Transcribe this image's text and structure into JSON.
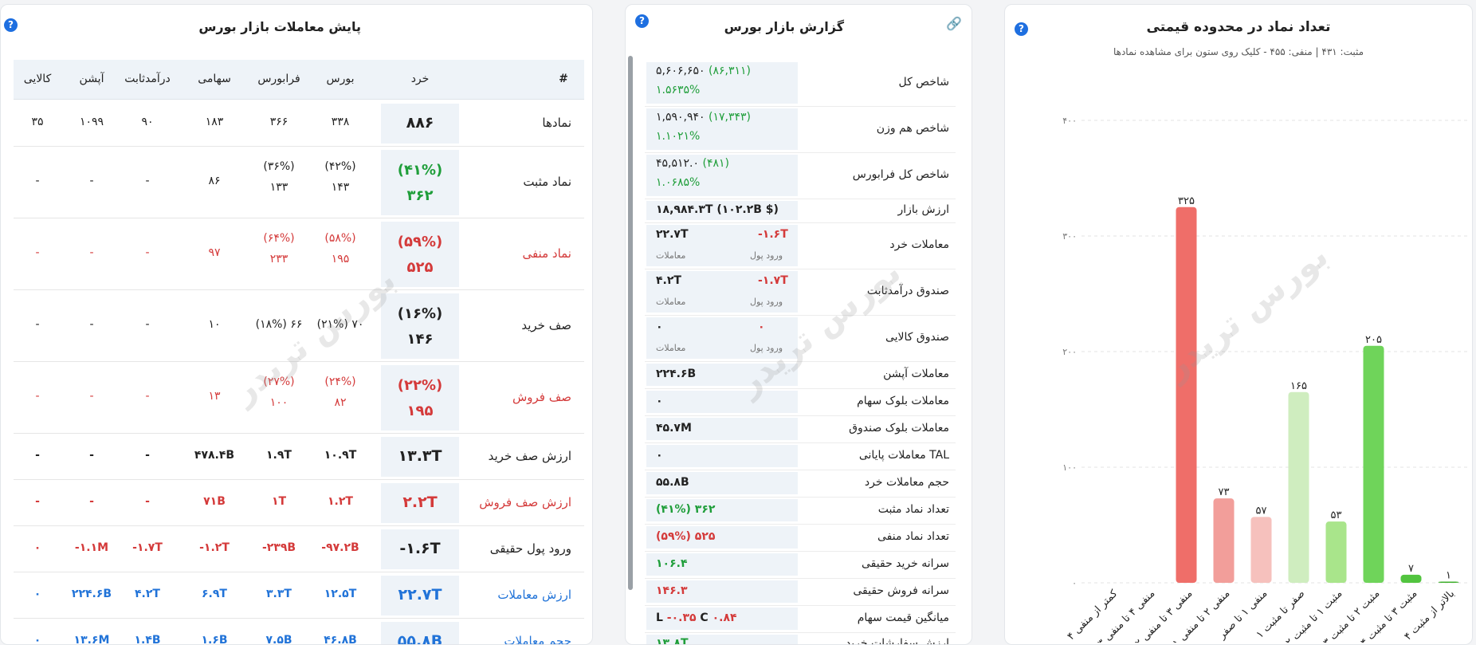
{
  "chart_panel": {
    "title": "تعداد نماد در محدوده قیمتی",
    "subtitle": "مثبت: ۴۳۱ | منفی: ۴۵۵ - کلیک روی ستون برای مشاهده نمادها",
    "watermark": "بورس تریدر"
  },
  "chart_data": {
    "type": "bar",
    "categories": [
      "کمتر از منفی ۴",
      "منفی ۴ تا منفی ۳",
      "منفی ۳ تا منفی ۲",
      "منفی ۲ تا منفی ۱",
      "منفی ۱ تا صفر",
      "صفر تا مثبت ۱",
      "مثبت ۱ تا مثبت ۲",
      "مثبت ۲ تا مثبت ۳",
      "مثبت ۳ تا مثبت ۴",
      "بالاتر از مثبت ۴"
    ],
    "values": [
      0,
      0,
      325,
      73,
      57,
      165,
      53,
      205,
      7,
      1
    ],
    "value_labels": [
      "",
      "",
      "۳۲۵",
      "۷۳",
      "۵۷",
      "۱۶۵",
      "۵۳",
      "۲۰۵",
      "۷",
      "۱"
    ],
    "colors": [
      "#e85b5b",
      "#ec6d6a",
      "#ef6e69",
      "#f29e9a",
      "#f6c1bd",
      "#cfedbf",
      "#a9e58b",
      "#6fd45a",
      "#52c43f",
      "#3faf2c"
    ],
    "ylim": [
      0,
      400
    ],
    "yticks": [
      0,
      100,
      200,
      300,
      400
    ],
    "ytick_labels": [
      "۰",
      "۱۰۰",
      "۲۰۰",
      "۳۰۰",
      "۴۰۰"
    ],
    "grid": true,
    "legend": "none"
  },
  "report_panel": {
    "title": "گزارش بازار بورس",
    "watermark": "بورس تریدر",
    "rows": [
      {
        "label": "شاخص کل",
        "v1": "۵,۶۰۶,۶۵۰",
        "v1b": "(۸۶,۳۱۱)",
        "v2": "۱.۵۶۳۵%"
      },
      {
        "label": "شاخص هم وزن",
        "v1": "۱,۵۹۰,۹۴۰",
        "v1b": "(۱۷,۳۴۳)",
        "v2": "۱.۱۰۲۱%"
      },
      {
        "label": "شاخص کل فرابورس",
        "v1": "۴۵,۵۱۲.۰",
        "v1b": "(۴۸۱)",
        "v2": "۱.۰۶۸۵%"
      },
      {
        "label": "ارزش بازار",
        "v1": "۱۸,۹۸۴.۳T (۱۰۲.۲B $)"
      },
      {
        "label": "معاملات خرد",
        "left": "۲۲.۷T",
        "right": "-۱.۶T",
        "left_sub": "معاملات",
        "right_sub": "ورود پول"
      },
      {
        "label": "صندوق درآمدثابت",
        "left": "۴.۲T",
        "right": "-۱.۷T",
        "left_sub": "معاملات",
        "right_sub": "ورود پول"
      },
      {
        "label": "صندوق کالایی",
        "left": "۰",
        "right": "۰",
        "left_sub": "معاملات",
        "right_sub": "ورود پول"
      },
      {
        "label": "معاملات آپشن",
        "v1": "۲۲۴.۶B"
      },
      {
        "label": "معاملات بلوک سهام",
        "v1": "۰"
      },
      {
        "label": "معاملات بلوک صندوق",
        "v1": "۴۵.۷M"
      },
      {
        "label": "معاملات پایانی TAL",
        "v1": "۰"
      },
      {
        "label": "حجم معاملات خرد",
        "v1": "۵۵.۸B"
      },
      {
        "label": "تعداد نماد مثبت",
        "v1": "(۴۱%) ۳۶۲"
      },
      {
        "label": "تعداد نماد منفی",
        "v1": "(۵۹%) ۵۲۵"
      },
      {
        "label": "سرانه خرید حقیقی",
        "v1": "۱۰۶.۴"
      },
      {
        "label": "سرانه فروش حقیقی",
        "v1": "۱۴۶.۳"
      },
      {
        "label": "میانگین قیمت سهام",
        "v1": "L -۰.۳۵ C ۰.۸۴"
      },
      {
        "label": "ارزش سفارشات خرید",
        "v1": "۱۳.۸T"
      }
    ]
  },
  "trade_panel": {
    "title": "پایش معاملات بازار بورس",
    "watermark": "بورس تریدر",
    "headers": [
      "#",
      "خرد",
      "بورس",
      "فرابورس",
      "سهامی",
      "درآمدثابت",
      "آپشن",
      "کالایی"
    ],
    "rows": [
      {
        "label": "نمادها",
        "khord": "۸۸۶",
        "cells": [
          "۳۳۸",
          "۳۶۶",
          "۱۸۳",
          "۹۰",
          "۱۰۹۹",
          "۳۵"
        ]
      },
      {
        "label": "نماد مثبت",
        "khord_pct": "(۴۱%)",
        "khord": "۳۶۲",
        "cells": [
          "(۴۲%)|۱۴۳",
          "(۳۶%)|۱۳۳",
          "۸۶",
          "-",
          "-",
          "-"
        ]
      },
      {
        "label": "نماد منفی",
        "khord_pct": "(۵۹%)",
        "khord": "۵۲۵",
        "cells": [
          "(۵۸%)|۱۹۵",
          "(۶۴%)|۲۳۳",
          "۹۷",
          "-",
          "-",
          "-"
        ]
      },
      {
        "label": "صف خرید",
        "khord_pct": "(۱۶%)",
        "khord": "۱۴۶",
        "cells": [
          "(۲۱%) ۷۰",
          "(۱۸%) ۶۶",
          "۱۰",
          "-",
          "-",
          "-"
        ]
      },
      {
        "label": "صف فروش",
        "khord_pct": "(۲۲%)",
        "khord": "۱۹۵",
        "cells": [
          "(۲۴%)|۸۲",
          "(۲۷%)|۱۰۰",
          "۱۳",
          "-",
          "-",
          "-"
        ]
      },
      {
        "label": "ارزش صف خرید",
        "khord": "۱۳.۳T",
        "cells": [
          "۱۰.۹T",
          "۱.۹T",
          "۴۷۸.۴B",
          "-",
          "-",
          "-"
        ]
      },
      {
        "label": "ارزش صف فروش",
        "khord": "۲.۲T",
        "cells": [
          "۱.۲T",
          "۱T",
          "۷۱B",
          "-",
          "-",
          "-"
        ]
      },
      {
        "label": "ورود پول حقیقی",
        "khord": "-۱.۶T",
        "cells": [
          "-۹۷.۲B",
          "-۲۳۹B",
          "-۱.۲T",
          "-۱.۷T",
          "-۱.۱M",
          "۰"
        ]
      },
      {
        "label": "ارزش معاملات",
        "khord": "۲۲.۷T",
        "cells": [
          "۱۲.۵T",
          "۳.۳T",
          "۶.۹T",
          "۴.۲T",
          "۲۲۴.۶B",
          "۰"
        ]
      },
      {
        "label": "حجم معاملات",
        "khord": "۵۵.۸B",
        "cells": [
          "۴۶.۸B",
          "۷.۵B",
          "۱.۶B",
          "۱.۴B",
          "۱۳.۶M",
          "۰"
        ]
      }
    ]
  },
  "icons": {
    "help": "?",
    "link": "link-icon"
  }
}
